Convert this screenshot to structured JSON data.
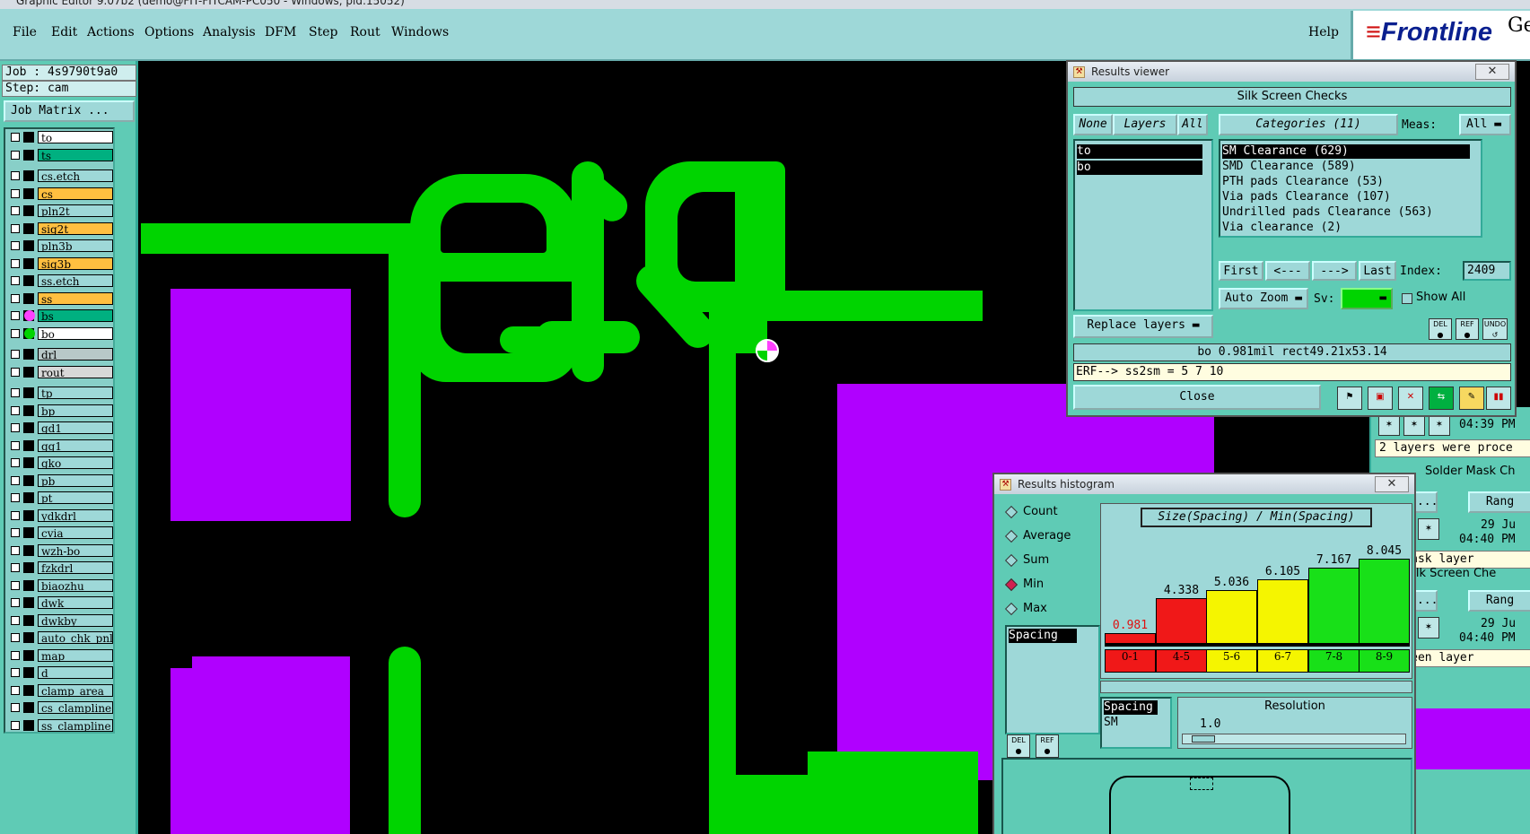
{
  "title_bar": "Graphic Editor 9.07b2 (demo@FIT-FITCAM-PC050 - Windows, pid:15052)",
  "menu": {
    "items": [
      "File",
      "Edit",
      "Actions",
      "Options",
      "Analysis",
      "DFM",
      "Step",
      "Rout",
      "Windows"
    ],
    "help": "Help",
    "logo": "Frontline",
    "logo_extra": "Ge"
  },
  "left_panel": {
    "job": "Job : 4s9790t9a0",
    "step": "Step: cam",
    "job_matrix": "Job Matrix ...",
    "layers": [
      {
        "name": "to",
        "color": "#ffffff"
      },
      {
        "name": "ts",
        "color": "#00b080"
      },
      {
        "name": "cs.etch",
        "color": "#9ed8d8"
      },
      {
        "name": "cs",
        "color": "#ffbf40"
      },
      {
        "name": "pln2t",
        "color": "#9ed8d8"
      },
      {
        "name": "sig2t",
        "color": "#ffbf40"
      },
      {
        "name": "pln3b",
        "color": "#9ed8d8"
      },
      {
        "name": "sig3b",
        "color": "#ffbf40"
      },
      {
        "name": "ss.etch",
        "color": "#9ed8d8"
      },
      {
        "name": "ss",
        "color": "#ffbf40"
      },
      {
        "name": "bs",
        "color": "#00b080"
      },
      {
        "name": "bo",
        "color": "#ffffff"
      },
      {
        "name": "drl",
        "color": "#b8c8c8"
      },
      {
        "name": "rout",
        "color": "#d8d8d8"
      },
      {
        "name": "tp",
        "color": "#9ed8d8"
      },
      {
        "name": "bp",
        "color": "#9ed8d8"
      },
      {
        "name": "gd1",
        "color": "#9ed8d8"
      },
      {
        "name": "gg1",
        "color": "#9ed8d8"
      },
      {
        "name": "gko",
        "color": "#9ed8d8"
      },
      {
        "name": "pb",
        "color": "#9ed8d8"
      },
      {
        "name": "pt",
        "color": "#9ed8d8"
      },
      {
        "name": "ydkdrl",
        "color": "#9ed8d8"
      },
      {
        "name": "cvia",
        "color": "#9ed8d8"
      },
      {
        "name": "wzh-bo",
        "color": "#9ed8d8"
      },
      {
        "name": "fzkdrl",
        "color": "#9ed8d8"
      },
      {
        "name": "biaozhu",
        "color": "#9ed8d8"
      },
      {
        "name": "dwk",
        "color": "#9ed8d8"
      },
      {
        "name": "dwkby",
        "color": "#9ed8d8"
      },
      {
        "name": "auto_chk_pnl",
        "color": "#9ed8d8"
      },
      {
        "name": "map",
        "color": "#9ed8d8"
      },
      {
        "name": "d",
        "color": "#9ed8d8"
      },
      {
        "name": "clamp_area",
        "color": "#9ed8d8"
      },
      {
        "name": "cs_clampline",
        "color": "#9ed8d8"
      },
      {
        "name": "ss_clampline",
        "color": "#9ed8d8"
      }
    ]
  },
  "results_viewer": {
    "title": "Results viewer",
    "close_x": "✕",
    "header": "Silk Screen Checks",
    "none": "None",
    "layers_label": "Layers",
    "all": "All",
    "categories_label": "Categories (11)",
    "meas_label": "Meas:",
    "meas_value": "All",
    "layer_items": [
      "to",
      "bo"
    ],
    "categories": [
      "SM Clearance (629)",
      "SMD Clearance (589)",
      "PTH pads Clearance (53)",
      "Via pads Clearance (107)",
      "Undrilled pads Clearance (563)",
      "Via clearance (2)"
    ],
    "first": "First",
    "prev": "<---",
    "next": "--->",
    "last": "Last",
    "index_label": "Index:",
    "index_value": "2409",
    "auto_zoom": "Auto Zoom",
    "sv_label": "Sv:",
    "show_all": "Show All",
    "replace_layers": "Replace layers",
    "del": "DEL",
    "ref": "REF",
    "undo": "UNDO",
    "status": "bo 0.981mil  rect49.21x53.14",
    "erf": "ERF--> ss2sm = 5 7 10",
    "close": "Close"
  },
  "results_histogram": {
    "title": "Results histogram",
    "close_x": "✕",
    "modes": [
      "Count",
      "Average",
      "Sum",
      "Min",
      "Max"
    ],
    "selected_mode": "Min",
    "list_item": "Spacing",
    "chart_title": "Size(Spacing) / Min(Spacing)",
    "del": "DEL",
    "ref": "REF",
    "lower_list": [
      "Spacing",
      "SM"
    ],
    "resolution_label": "Resolution",
    "resolution_value": "1.0"
  },
  "chart_data": {
    "type": "bar",
    "title": "Size(Spacing) / Min(Spacing)",
    "categories": [
      "0-1",
      "4-5",
      "5-6",
      "6-7",
      "7-8",
      "8-9"
    ],
    "values": [
      0.981,
      4.338,
      5.036,
      6.105,
      7.167,
      8.045
    ],
    "labels": [
      "0.981",
      "4.338",
      "5.036",
      "6.105",
      "7.167",
      "8.045"
    ],
    "colors": [
      "#f01818",
      "#f01818",
      "#f5f500",
      "#f5f500",
      "#18e018",
      "#18e018"
    ],
    "ylim": [
      0,
      8.6
    ]
  },
  "background_panel": {
    "time1": "04:39 PM",
    "msg1": "2 layers were proce",
    "solder_mask": "Solder Mask Ch",
    "meters1": "neters...",
    "range1": "Rang",
    "date1": "29 Ju",
    "time2": "04:40 PM",
    "mask_layer": "ler Mask layer",
    "silk_screen": "Silk Screen Che",
    "meters2": "neters...",
    "range2": "Rang",
    "date2": "29 Ju",
    "time3": "04:40 PM",
    "screen_layer": "t Screen layer"
  },
  "colors": {
    "panel": "#5fcbb5",
    "light_panel": "#9ed8d8",
    "silk_green": "#00d400",
    "pad_magenta": "#b000ff",
    "canvas": "#000000"
  }
}
